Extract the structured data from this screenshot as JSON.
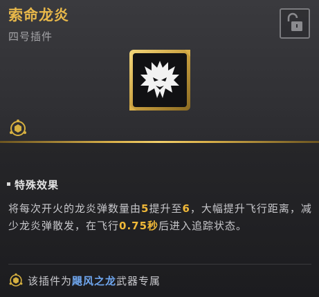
{
  "title": "索命龙炎",
  "subtitle": "四号插件",
  "icons": {
    "lock": "unlock-icon",
    "emblem": "dragon-emblem-icon",
    "plugin_type": "plugin-type-icon",
    "exclusive": "plugin-type-icon"
  },
  "effect": {
    "heading": "特殊效果",
    "seg1": "将每次开火的龙炎弹数量由",
    "val_from": "5",
    "seg2": "提升至",
    "val_to": "6",
    "seg3": "，大幅提升飞行距离，减少龙炎弹散发，在飞行",
    "val_time": "0.75秒",
    "seg4": "后进入追踪状态。"
  },
  "exclusive": {
    "prefix": "该插件为",
    "weapon": "飓风之龙",
    "suffix": "武器专属"
  },
  "colors": {
    "title": "#e8b84a",
    "highlight": "#f0b838",
    "weapon": "#6fa6ee",
    "gold_rule": "#d9b04a"
  }
}
